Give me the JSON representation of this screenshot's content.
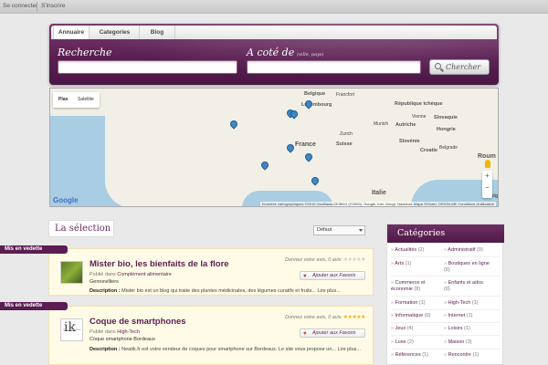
{
  "topbar": {
    "login": "Se connecter",
    "register": "S'inscrire"
  },
  "nav": {
    "tabs": [
      "Annuaire",
      "Categories",
      "Blog"
    ]
  },
  "search": {
    "label_what": "Recherche",
    "label_where": "A coté de",
    "label_where_hint": "(ville, pays)",
    "what_value": "",
    "where_value": "",
    "button": "Chercher"
  },
  "map": {
    "type_buttons": [
      "Plan",
      "Satellite"
    ],
    "countries": [
      "Belgique",
      "Luxembourg",
      "République tchèque",
      "Slovaquie",
      "Autriche",
      "Hongrie",
      "Suisse",
      "Slovénie",
      "Croatie",
      "Italie",
      "Roum",
      "Bulg",
      "France"
    ],
    "cities": [
      "Francfort",
      "Munich",
      "Zurich",
      "Vienne",
      "Belgrade",
      "Rouma"
    ],
    "logo": "Google",
    "attribution": "Données cartographiques ©2016 GeoBasis-DE/BKG (©2009), Google, Inst. Geogr. Nacional, Mapa GISrael, ORION-ME  Conditions d'utilisation",
    "zoom_in": "+",
    "zoom_out": "−"
  },
  "selection": {
    "title": "La sélection",
    "sort": "Défaut",
    "listings": [
      {
        "badge": "Mis en vedette",
        "title": "Mister bio, les bienfaits de la flore",
        "published_prefix": "Publié dans",
        "category": "Complément alimentaire",
        "location": "Gennevilliers",
        "rating_text": "Donnez votre avis, 0 avis",
        "stars": "★★★★★",
        "description_label": "Description :",
        "description": "Mister bio est un blog qui traite des plantes médicinales, des légumes curatifs et fruits... Lire plus...",
        "fav_button": "Ajouter aux Favoris"
      },
      {
        "badge": "Mis en vedette",
        "title": "Coque de smartphones",
        "published_prefix": "Publié dans",
        "category": "High-Tech",
        "location": "Coque smartphone Bordeaux",
        "rating_text": "Donnez votre avis, 0 avis",
        "stars": "★★★★★",
        "description_label": "Description :",
        "description": "Neatik.fr est votre vendeur de coques pour smartphone sur Bordeaux. Le site vous propose un... Lire plus...",
        "fav_button": "Ajouter aux Favoris",
        "thumb_text": "ik",
        "thumb_sub": "smartphones"
      }
    ]
  },
  "categories": {
    "title": "Catégories",
    "left": [
      {
        "name": "Actualités",
        "count": "(2)"
      },
      {
        "name": "Arts",
        "count": "(1)"
      },
      {
        "name": "Commerce et économie",
        "count": "(8)"
      },
      {
        "name": "Formation",
        "count": "(1)"
      },
      {
        "name": "Informatique",
        "count": "(0)"
      },
      {
        "name": "Jeux",
        "count": "(4)"
      },
      {
        "name": "Luxe",
        "count": "(2)"
      },
      {
        "name": "Références",
        "count": "(1)"
      }
    ],
    "right": [
      {
        "name": "Administratif",
        "count": "(0)"
      },
      {
        "name": "Boutiques en ligne",
        "count": "(6)"
      },
      {
        "name": "Enfants et ados",
        "count": "(0)"
      },
      {
        "name": "High-Tech",
        "count": "(1)"
      },
      {
        "name": "Internet",
        "count": "(1)"
      },
      {
        "name": "Loisirs",
        "count": "(1)"
      },
      {
        "name": "Maison",
        "count": "(3)"
      },
      {
        "name": "Rencontre",
        "count": "(1)"
      }
    ]
  }
}
